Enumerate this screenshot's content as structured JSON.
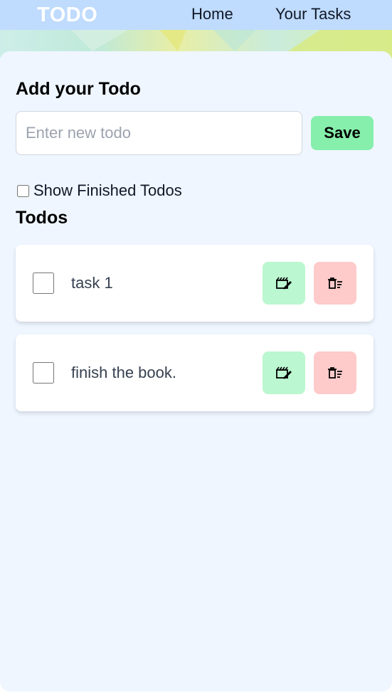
{
  "navbar": {
    "brand": "TODO",
    "links": [
      {
        "label": "Home"
      },
      {
        "label": "Your Tasks"
      }
    ]
  },
  "add_section": {
    "title": "Add your Todo",
    "input_value": "",
    "input_placeholder": "Enter new todo",
    "save_label": "Save"
  },
  "show_finished": {
    "label": "Show Finished Todos",
    "checked": false
  },
  "todos_section": {
    "title": "Todos",
    "items": [
      {
        "text": "task 1",
        "completed": false,
        "edit_icon": "edit-icon",
        "delete_icon": "delete-icon"
      },
      {
        "text": "finish the book.",
        "completed": false,
        "edit_icon": "edit-icon",
        "delete_icon": "delete-icon"
      }
    ]
  },
  "colors": {
    "navbar_bg": "#bfdbfe",
    "card_bg": "#eff6ff",
    "save_bg": "#86efac",
    "edit_bg": "#bbf7d0",
    "delete_bg": "#fecaca"
  }
}
